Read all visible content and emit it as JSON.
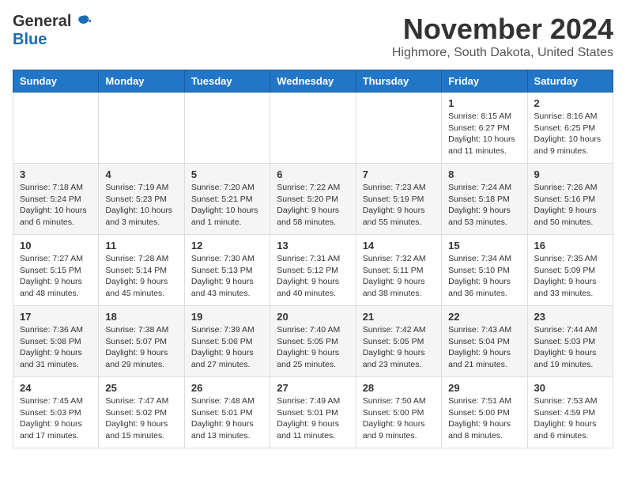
{
  "header": {
    "logo_general": "General",
    "logo_blue": "Blue",
    "month": "November 2024",
    "location": "Highmore, South Dakota, United States"
  },
  "weekdays": [
    "Sunday",
    "Monday",
    "Tuesday",
    "Wednesday",
    "Thursday",
    "Friday",
    "Saturday"
  ],
  "weeks": [
    [
      {
        "day": "",
        "info": ""
      },
      {
        "day": "",
        "info": ""
      },
      {
        "day": "",
        "info": ""
      },
      {
        "day": "",
        "info": ""
      },
      {
        "day": "",
        "info": ""
      },
      {
        "day": "1",
        "info": "Sunrise: 8:15 AM\nSunset: 6:27 PM\nDaylight: 10 hours\nand 11 minutes."
      },
      {
        "day": "2",
        "info": "Sunrise: 8:16 AM\nSunset: 6:25 PM\nDaylight: 10 hours\nand 9 minutes."
      }
    ],
    [
      {
        "day": "3",
        "info": "Sunrise: 7:18 AM\nSunset: 5:24 PM\nDaylight: 10 hours\nand 6 minutes."
      },
      {
        "day": "4",
        "info": "Sunrise: 7:19 AM\nSunset: 5:23 PM\nDaylight: 10 hours\nand 3 minutes."
      },
      {
        "day": "5",
        "info": "Sunrise: 7:20 AM\nSunset: 5:21 PM\nDaylight: 10 hours\nand 1 minute."
      },
      {
        "day": "6",
        "info": "Sunrise: 7:22 AM\nSunset: 5:20 PM\nDaylight: 9 hours\nand 58 minutes."
      },
      {
        "day": "7",
        "info": "Sunrise: 7:23 AM\nSunset: 5:19 PM\nDaylight: 9 hours\nand 55 minutes."
      },
      {
        "day": "8",
        "info": "Sunrise: 7:24 AM\nSunset: 5:18 PM\nDaylight: 9 hours\nand 53 minutes."
      },
      {
        "day": "9",
        "info": "Sunrise: 7:26 AM\nSunset: 5:16 PM\nDaylight: 9 hours\nand 50 minutes."
      }
    ],
    [
      {
        "day": "10",
        "info": "Sunrise: 7:27 AM\nSunset: 5:15 PM\nDaylight: 9 hours\nand 48 minutes."
      },
      {
        "day": "11",
        "info": "Sunrise: 7:28 AM\nSunset: 5:14 PM\nDaylight: 9 hours\nand 45 minutes."
      },
      {
        "day": "12",
        "info": "Sunrise: 7:30 AM\nSunset: 5:13 PM\nDaylight: 9 hours\nand 43 minutes."
      },
      {
        "day": "13",
        "info": "Sunrise: 7:31 AM\nSunset: 5:12 PM\nDaylight: 9 hours\nand 40 minutes."
      },
      {
        "day": "14",
        "info": "Sunrise: 7:32 AM\nSunset: 5:11 PM\nDaylight: 9 hours\nand 38 minutes."
      },
      {
        "day": "15",
        "info": "Sunrise: 7:34 AM\nSunset: 5:10 PM\nDaylight: 9 hours\nand 36 minutes."
      },
      {
        "day": "16",
        "info": "Sunrise: 7:35 AM\nSunset: 5:09 PM\nDaylight: 9 hours\nand 33 minutes."
      }
    ],
    [
      {
        "day": "17",
        "info": "Sunrise: 7:36 AM\nSunset: 5:08 PM\nDaylight: 9 hours\nand 31 minutes."
      },
      {
        "day": "18",
        "info": "Sunrise: 7:38 AM\nSunset: 5:07 PM\nDaylight: 9 hours\nand 29 minutes."
      },
      {
        "day": "19",
        "info": "Sunrise: 7:39 AM\nSunset: 5:06 PM\nDaylight: 9 hours\nand 27 minutes."
      },
      {
        "day": "20",
        "info": "Sunrise: 7:40 AM\nSunset: 5:05 PM\nDaylight: 9 hours\nand 25 minutes."
      },
      {
        "day": "21",
        "info": "Sunrise: 7:42 AM\nSunset: 5:05 PM\nDaylight: 9 hours\nand 23 minutes."
      },
      {
        "day": "22",
        "info": "Sunrise: 7:43 AM\nSunset: 5:04 PM\nDaylight: 9 hours\nand 21 minutes."
      },
      {
        "day": "23",
        "info": "Sunrise: 7:44 AM\nSunset: 5:03 PM\nDaylight: 9 hours\nand 19 minutes."
      }
    ],
    [
      {
        "day": "24",
        "info": "Sunrise: 7:45 AM\nSunset: 5:03 PM\nDaylight: 9 hours\nand 17 minutes."
      },
      {
        "day": "25",
        "info": "Sunrise: 7:47 AM\nSunset: 5:02 PM\nDaylight: 9 hours\nand 15 minutes."
      },
      {
        "day": "26",
        "info": "Sunrise: 7:48 AM\nSunset: 5:01 PM\nDaylight: 9 hours\nand 13 minutes."
      },
      {
        "day": "27",
        "info": "Sunrise: 7:49 AM\nSunset: 5:01 PM\nDaylight: 9 hours\nand 11 minutes."
      },
      {
        "day": "28",
        "info": "Sunrise: 7:50 AM\nSunset: 5:00 PM\nDaylight: 9 hours\nand 9 minutes."
      },
      {
        "day": "29",
        "info": "Sunrise: 7:51 AM\nSunset: 5:00 PM\nDaylight: 9 hours\nand 8 minutes."
      },
      {
        "day": "30",
        "info": "Sunrise: 7:53 AM\nSunset: 4:59 PM\nDaylight: 9 hours\nand 6 minutes."
      }
    ]
  ]
}
